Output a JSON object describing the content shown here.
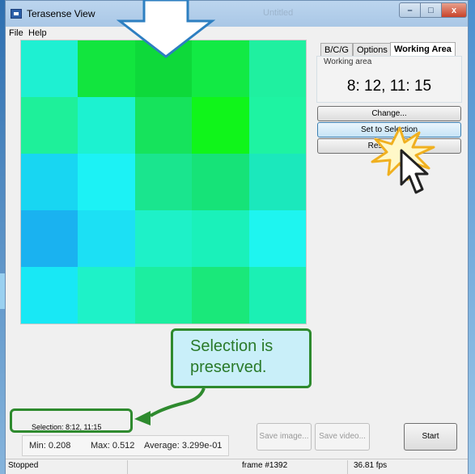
{
  "window": {
    "title": "Terasense View",
    "ghost_title": "Untitled",
    "min_label": "–",
    "max_label": "□",
    "close_label": "x"
  },
  "menu": [
    {
      "label": "File"
    },
    {
      "label": "Help"
    }
  ],
  "heatmap": {
    "rows": 5,
    "cols": 5,
    "colors": [
      [
        "#1ef0d2",
        "#12e53e",
        "#0ed93a",
        "#12ea44",
        "#1ff0a0"
      ],
      [
        "#1ef09a",
        "#1cf2d0",
        "#16e35c",
        "#10f51a",
        "#1ef3a2"
      ],
      [
        "#18d6f2",
        "#1cf2f5",
        "#1ae58e",
        "#16e378",
        "#1be8bc"
      ],
      [
        "#1ab2f0",
        "#1ce0f4",
        "#1ef1c8",
        "#1af1ba",
        "#1ef5f0"
      ],
      [
        "#18e8f5",
        "#1ef2c8",
        "#1ceea0",
        "#1ae87a",
        "#1bf0b4"
      ]
    ]
  },
  "tabs": [
    {
      "label": "B/C/G",
      "active": false
    },
    {
      "label": "Options",
      "active": false
    },
    {
      "label": "Working Area",
      "active": true
    }
  ],
  "working_area": {
    "group_label": "Working area",
    "value": "8: 12,  11: 15"
  },
  "buttons": {
    "change": "Change...",
    "set_to_selection": "Set to Selection",
    "reset_to_full": "Reset to full",
    "save_image": "Save image...",
    "save_video": "Save video...",
    "start": "Start"
  },
  "callout": {
    "line1": "Selection is",
    "line2": "preserved.",
    "color": "#2e8a2e",
    "fill": "#c9eff9"
  },
  "selection_text": "Selection: 8:12, 11:15",
  "stats": {
    "min": "Min: 0.208",
    "max": "Max: 0.512",
    "average": "Average: 3.299e-01"
  },
  "status": {
    "state": "Stopped",
    "frame": "frame #1392",
    "fps": "36.81 fps"
  },
  "icons": {
    "arrow": "down-arrow-icon",
    "cursor": "mouse-cursor-icon",
    "burst": "click-burst-icon"
  }
}
